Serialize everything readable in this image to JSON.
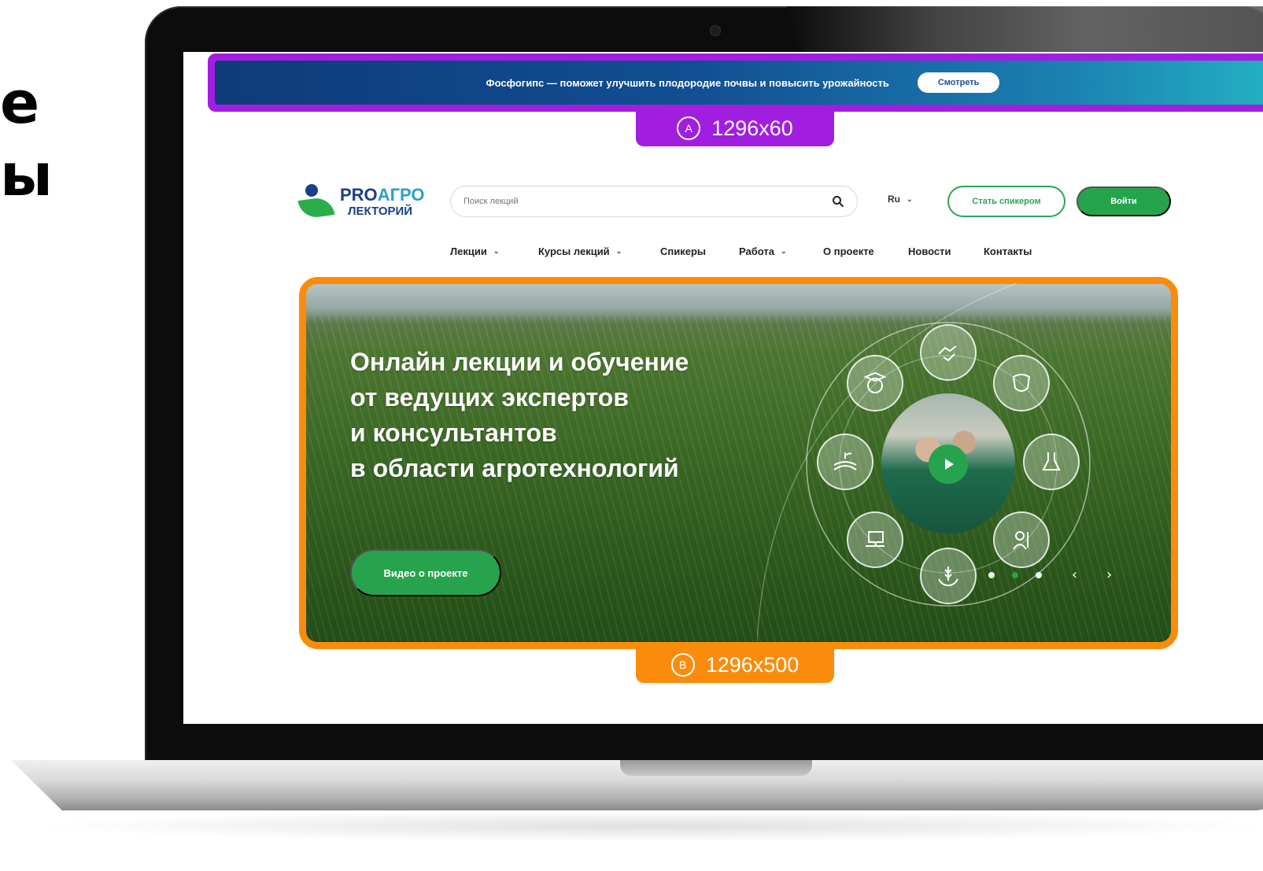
{
  "side_text": {
    "line1": "е",
    "line2": "ы"
  },
  "promo": {
    "text": "Фосфогипс — поможет улучшить плодородие почвы и повысить урожайность",
    "button": "Смотреть",
    "tag_letter": "A",
    "tag_size": "1296x60",
    "frame_color": "#a11ee0"
  },
  "logo": {
    "line1_a": "PRO",
    "line1_b": "АГРО",
    "line2": "ЛЕКТОРИЙ"
  },
  "search": {
    "placeholder": "Поиск лекций",
    "icon": "search-icon"
  },
  "lang": {
    "value": "Ru"
  },
  "header_buttons": {
    "speaker": "Стать спикером",
    "login": "Войти"
  },
  "nav": {
    "items": [
      {
        "label": "Лекции",
        "has_dropdown": true
      },
      {
        "label": "Курсы лекций",
        "has_dropdown": true
      },
      {
        "label": "Спикеры",
        "has_dropdown": false
      },
      {
        "label": "Работа",
        "has_dropdown": true
      },
      {
        "label": "О проекте",
        "has_dropdown": false
      },
      {
        "label": "Новости",
        "has_dropdown": false
      },
      {
        "label": "Контакты",
        "has_dropdown": false
      }
    ]
  },
  "hero": {
    "title_lines": [
      "Онлайн лекции и обучение",
      "от ведущих экспертов",
      "и консультантов",
      "в области агротехнологий"
    ],
    "video_button": "Видео о проекте",
    "tag_letter": "B",
    "tag_size": "1296x500",
    "frame_color": "#fb8c0b",
    "icons": [
      "graduation-globe-icon",
      "handshake-icon",
      "cow-icon",
      "field-sprout-icon",
      "lab-flask-icon",
      "computer-network-icon",
      "hands-wheat-icon",
      "farmer-icon"
    ],
    "slider": {
      "count": 3,
      "active": 2
    },
    "accent": "#27a34e"
  }
}
